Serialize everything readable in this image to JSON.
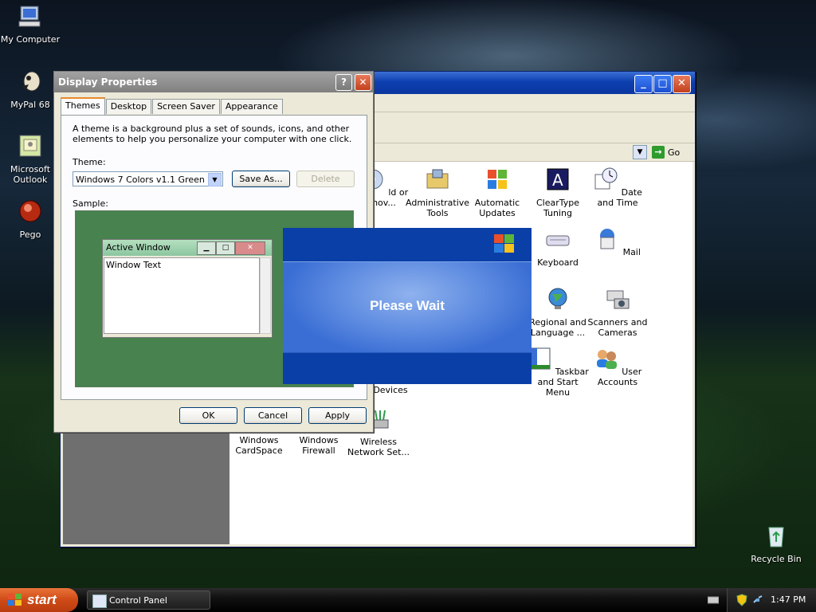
{
  "desktop": {
    "icons": [
      {
        "label": "My Computer",
        "icon": "my-computer-icon"
      },
      {
        "label": "MyPal 68",
        "icon": "mypal-icon"
      },
      {
        "label": "Microsoft Outlook",
        "icon": "outlook-icon"
      },
      {
        "label": "Pego",
        "icon": "pego-icon"
      },
      {
        "label": "Recycle Bin",
        "icon": "recycle-bin-icon"
      }
    ]
  },
  "control_panel": {
    "title_buttons": {
      "minimize": "_",
      "maximize": "□",
      "close": "✕"
    },
    "address_go": "Go",
    "items": [
      {
        "label": "ld or nov...",
        "icon": "add-remove-programs-icon"
      },
      {
        "label": "Administrative Tools",
        "icon": "administrative-tools-icon"
      },
      {
        "label": "Automatic Updates",
        "icon": "automatic-updates-icon"
      },
      {
        "label": "ClearType Tuning",
        "icon": "cleartype-icon"
      },
      {
        "label": "Date and Time",
        "icon": "date-time-icon"
      },
      {
        "label": "Keyboard",
        "icon": "keyboard-icon"
      },
      {
        "label": "Mail",
        "icon": "mail-icon"
      },
      {
        "label": "Regional and Language ...",
        "icon": "regional-language-icon"
      },
      {
        "label": "Scanners and Cameras",
        "icon": "scanners-cameras-icon"
      },
      {
        "label": "Devices",
        "icon": "devices-icon"
      },
      {
        "label": "Taskbar and Start Menu",
        "icon": "taskbar-startmenu-icon"
      },
      {
        "label": "User Accounts",
        "icon": "user-accounts-icon"
      },
      {
        "label": "Windows CardSpace",
        "icon": "cardspace-icon"
      },
      {
        "label": "Windows Firewall",
        "icon": "firewall-icon"
      },
      {
        "label": "Wireless Network Set...",
        "icon": "wireless-network-icon"
      }
    ]
  },
  "display_properties": {
    "title": "Display Properties",
    "help_button": "?",
    "close_button": "✕",
    "tabs": [
      "Themes",
      "Desktop",
      "Screen Saver",
      "Appearance"
    ],
    "active_tab": "Themes",
    "description": "A theme is a background plus a set of sounds, icons, and other elements to help you personalize your computer with one click.",
    "theme_label": "Theme:",
    "theme_value": "Windows 7 Colors v1.1 Green",
    "save_as_label": "Save As...",
    "delete_label": "Delete",
    "sample_label": "Sample:",
    "sample": {
      "window_title": "Active Window",
      "window_text": "Window Text",
      "background_color": "#47824f"
    },
    "ok_label": "OK",
    "cancel_label": "Cancel",
    "apply_label": "Apply"
  },
  "splash": {
    "message": "Please Wait"
  },
  "taskbar": {
    "start_label": "start",
    "task_button_label": "Control Panel",
    "clock": "1:47 PM"
  }
}
